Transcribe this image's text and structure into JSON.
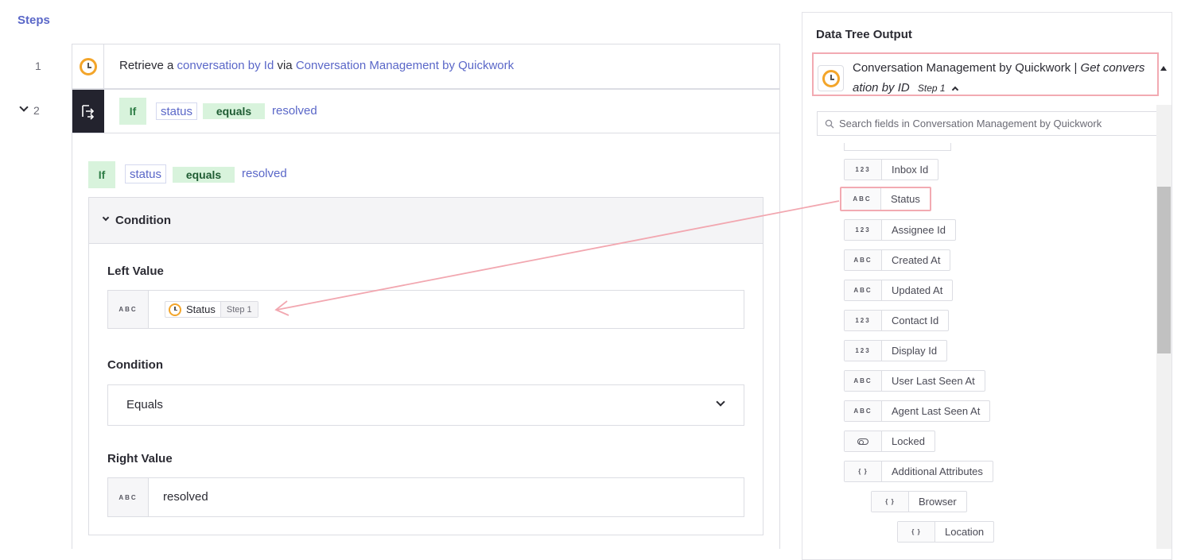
{
  "steps": {
    "title": "Steps",
    "step1": {
      "number": "1",
      "prefix": "Retrieve a",
      "object_link": "conversation by Id",
      "via": "via",
      "app_link": "Conversation Management by Quickwork"
    },
    "step2": {
      "number": "2",
      "if_label": "If",
      "field": "status",
      "operator": "equals",
      "value": "resolved"
    }
  },
  "condition_panel": {
    "summary": {
      "if_label": "If",
      "field": "status",
      "operator": "equals",
      "value": "resolved"
    },
    "header_label": "Condition",
    "left_value": {
      "label": "Left Value",
      "type": "ABC",
      "pill_text": "Status",
      "pill_step": "Step 1"
    },
    "condition": {
      "label": "Condition",
      "selected": "Equals"
    },
    "right_value": {
      "label": "Right Value",
      "type": "ABC",
      "value": "resolved"
    }
  },
  "data_tree": {
    "title": "Data Tree Output",
    "app_name": "Conversation Management by Quickwork |",
    "action_part1": "Get convers",
    "action_part2": "ation by ID",
    "step_label": "Step 1",
    "search_placeholder": "Search fields in Conversation Management by Quickwork",
    "items": [
      {
        "type": "123",
        "label": "Inbox Id"
      },
      {
        "type": "ABC",
        "label": "Status"
      },
      {
        "type": "123",
        "label": "Assignee Id"
      },
      {
        "type": "ABC",
        "label": "Created At"
      },
      {
        "type": "ABC",
        "label": "Updated At"
      },
      {
        "type": "123",
        "label": "Contact Id"
      },
      {
        "type": "123",
        "label": "Display Id"
      },
      {
        "type": "ABC",
        "label": "User Last Seen At"
      },
      {
        "type": "ABC",
        "label": "Agent Last Seen At"
      },
      {
        "type": "toggle",
        "label": "Locked"
      },
      {
        "type": "{ }",
        "label": "Additional Attributes"
      },
      {
        "type": "{ }",
        "label": "Browser"
      },
      {
        "type": "{ }",
        "label": "Location"
      }
    ]
  },
  "colors": {
    "accent": "#5a67c8",
    "highlight": "#f2aab2",
    "green_tag": "#d8f3dc",
    "logo_orange": "#f3a52a"
  }
}
